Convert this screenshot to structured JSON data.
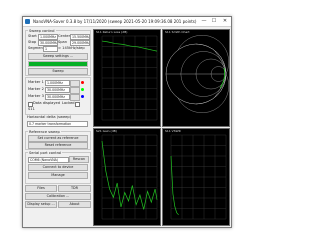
{
  "window": {
    "title": "NanoVNA-Saver 0.3.8 by 17/11/2020 (sweep 2021-05-20 19:09:36.08 201 points)",
    "minimize": "—",
    "maximize": "☐",
    "close": "✕"
  },
  "sweep": {
    "group_label": "Sweep control",
    "start_label": "Start",
    "start_value": "1.000MHz",
    "stop_label": "Stop",
    "stop_value": "30.000MHz",
    "center_label": "Center",
    "center_value": "15.500MHz",
    "span_label": "Span",
    "span_value": "29.000MHz",
    "segments_label": "Segments",
    "segments_value": "1",
    "step_value": "≈ 145kHz/step",
    "sweep_button": "Sweep",
    "settings_button": "Sweep settings ...",
    "progress": 1.0
  },
  "markers": {
    "marker1_label": "Marker 1",
    "marker1_value": "1.000MHz",
    "marker1_color": "#ff0000",
    "marker2_label": "Marker 2",
    "marker2_value": "30.000MHz",
    "marker2_color": "#00ff00",
    "marker3_label": "Marker 3",
    "marker3_value": "30.000MHz",
    "marker3_color": "#0000ff",
    "show_data_label": "Data displayed",
    "lock_label": "Locked",
    "move_button": "Move"
  },
  "s11": {
    "label": "S11",
    "freq_label": "Horizontal delta (sweep)",
    "freq_value": "0.7 marker transformation"
  },
  "reference": {
    "group_label": "Reference sweep",
    "set_button": "Set current as reference",
    "reset_button": "Reset reference"
  },
  "serial": {
    "group_label": "Serial port control",
    "port_value": "COM6 (NanoVNA)",
    "rescan_button": "Rescan",
    "connect_button": "Connect to device",
    "manage_button": "Manage"
  },
  "bottom": {
    "files_button": "Files",
    "calibration_button": "Calibration ...",
    "time_button": "TDR",
    "display_button": "Display setup ...",
    "about_button": "About"
  },
  "charts": {
    "tl_title": "S11 Return Loss (dB)",
    "tr_title": "S11 Smith Chart",
    "bl_title": "S21 Gain (dB)",
    "br_title": "S11 VSWR"
  },
  "chart_data": [
    {
      "type": "line",
      "title": "S11 Return Loss (dB)",
      "x": [
        1,
        4,
        8,
        12,
        16,
        20,
        24,
        28,
        30
      ],
      "series": [
        {
          "values": [
            -0.6,
            -0.7,
            -0.9,
            -1.0,
            -1.2,
            -1.3,
            -1.5,
            -1.7,
            -1.8
          ]
        }
      ],
      "xlim": [
        1,
        30
      ],
      "grid": true
    },
    {
      "type": "line",
      "title": "S21 Gain (dB)",
      "x": [
        1,
        3,
        5,
        7,
        9,
        11,
        13,
        15,
        17,
        19,
        21,
        23,
        25,
        27,
        29,
        30
      ],
      "series": [
        {
          "values": [
            -5,
            -30,
            -45,
            -52,
            -40,
            -60,
            -48,
            -55,
            -42,
            -58,
            -50,
            -62,
            -47,
            -56,
            -45,
            -54
          ]
        }
      ],
      "xlim": [
        1,
        30
      ],
      "grid": true
    },
    {
      "type": "line",
      "title": "S11 VSWR",
      "x": [
        1,
        2,
        3,
        4,
        5
      ],
      "series": [
        {
          "values": [
            30,
            12,
            6,
            3,
            2
          ]
        }
      ],
      "xlim": [
        1,
        30
      ],
      "grid": true
    }
  ],
  "colors": {
    "trace": "#22c522",
    "grid": "#3c3c3c",
    "smith": "#bfbfbf",
    "accent": "#1e6fb8"
  }
}
